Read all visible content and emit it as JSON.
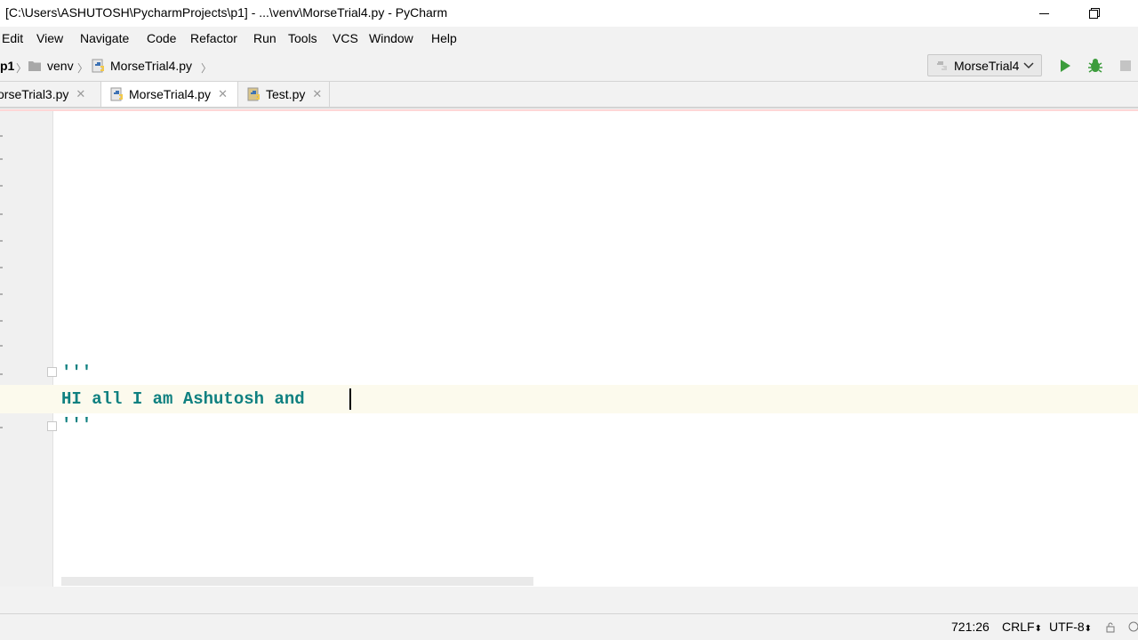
{
  "window": {
    "title": "[C:\\Users\\ASHUTOSH\\PycharmProjects\\p1] - ...\\venv\\MorseTrial4.py - PyCharm"
  },
  "menu": [
    "Edit",
    "View",
    "Navigate",
    "Code",
    "Refactor",
    "Run",
    "Tools",
    "VCS",
    "Window",
    "Help"
  ],
  "breadcrumbs": {
    "project": "p1",
    "folder": "venv",
    "file": "MorseTrial4.py"
  },
  "run_config": {
    "label": "MorseTrial4"
  },
  "tabs": [
    {
      "label": "orseTrial3.py",
      "active": false
    },
    {
      "label": "MorseTrial4.py",
      "active": true
    },
    {
      "label": "Test.py",
      "active": false
    }
  ],
  "editor": {
    "lines": [
      "'''",
      "HI all I am Ashutosh and ",
      "'''"
    ]
  },
  "status": {
    "position": "721:26",
    "line_sep": "CRLF",
    "encoding": "UTF-8"
  },
  "colors": {
    "code": "#0f8080",
    "run_green": "#3c9c3c",
    "python_blue": "#3d72b4",
    "python_yellow": "#f2c94c"
  }
}
